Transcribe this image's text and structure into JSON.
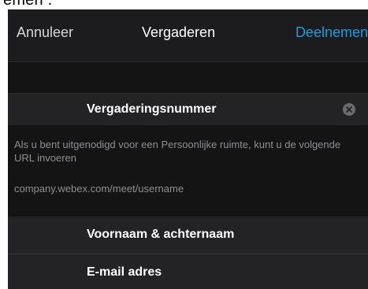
{
  "top_strip": {
    "text": "emen ."
  },
  "nav": {
    "cancel_label": "Annuleer",
    "title": "Vergaderen",
    "join_label": "Deelnemen"
  },
  "meeting": {
    "placeholder": "Vergaderingsnummer",
    "clear_icon": "clear-circle-x"
  },
  "info": {
    "text": "Als u bent uitgenodigd voor een Persoonlijke ruimte, kunt u de volgende URL invoeren",
    "url": "company.webex.com/meet/username"
  },
  "fields": {
    "name_placeholder": "Voornaam & achternaam",
    "email_placeholder": "E-mail adres"
  },
  "colors": {
    "background": "#1c1c1e",
    "accent": "#1a9de0",
    "secondary_text": "#8e8e93"
  }
}
